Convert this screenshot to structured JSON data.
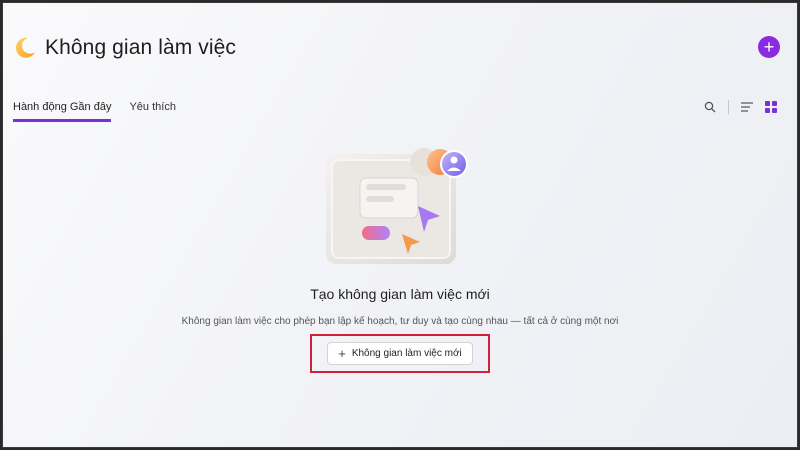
{
  "header": {
    "title": "Không gian làm việc",
    "add_label": "+",
    "logo_icon": "crescent-moon-icon"
  },
  "tabs": [
    {
      "label": "Hành động Gần đây",
      "active": true
    },
    {
      "label": "Yêu thích",
      "active": false
    }
  ],
  "view_controls": [
    "search-icon",
    "list-view-icon",
    "grid-view-icon"
  ],
  "empty_state": {
    "title": "Tạo không gian làm việc mới",
    "description": "Không gian làm việc cho phép bạn lập kế hoạch, tư duy và tạo cùng nhau — tất cả ở cùng một nơi",
    "button_label": "Không gian làm việc mới",
    "button_icon": "+"
  },
  "colors": {
    "accent": "#8a2be2",
    "tab_underline": "#7b2fd6",
    "highlight_box": "#d0203a"
  }
}
